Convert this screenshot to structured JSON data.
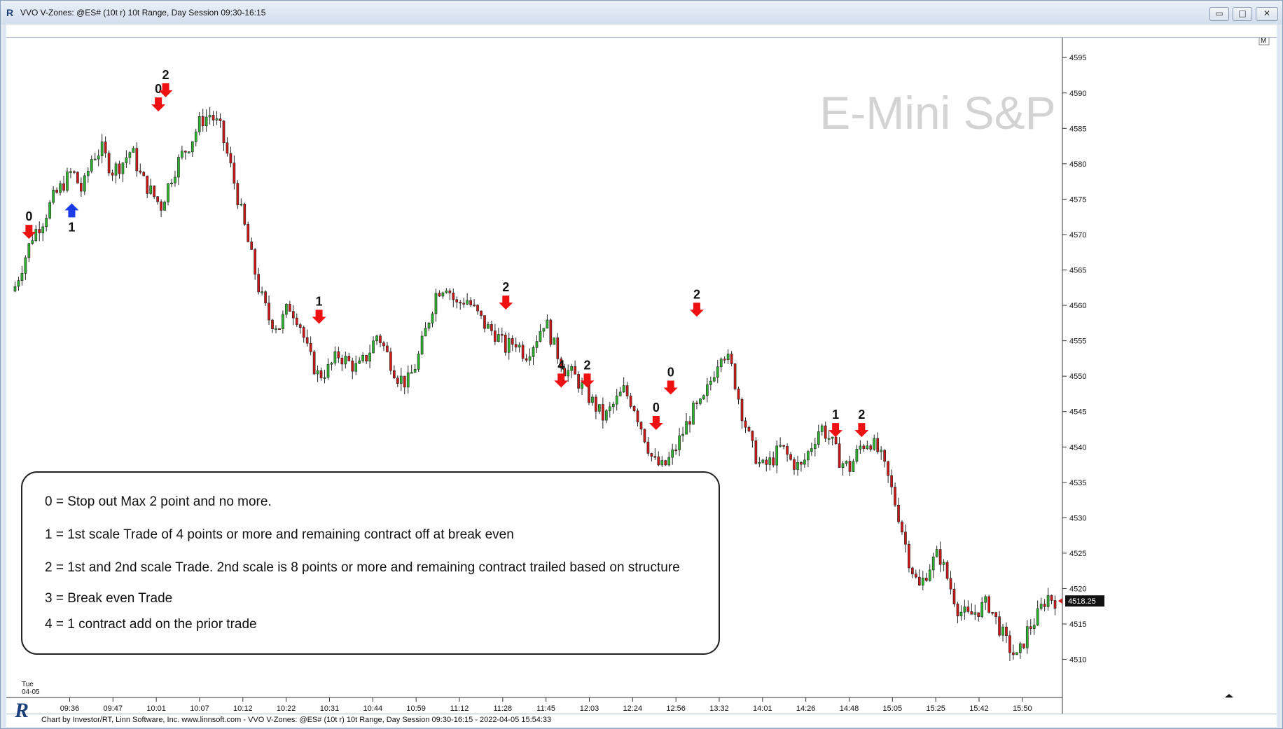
{
  "window": {
    "title": "VVO V-Zones: @ES# (10t r) 10t Range, Day Session 09:30-16:15",
    "buttons": {
      "minimize": "▭",
      "maximize": "□",
      "close": "✕"
    }
  },
  "footer": {
    "text": "Chart by Investor/RT, Linn Software, Inc. www.linnsoft.com - VVO V-Zones: @ES# (10t r) 10t Range, Day Session 09:30-16:15 - 2022-04-05 15:54:33",
    "logo": "R"
  },
  "chart_data": {
    "type": "candlestick",
    "watermark": "E-Mini S&P",
    "price_axis": {
      "ticks": [
        4510,
        4515,
        4520,
        4525,
        4530,
        4535,
        4540,
        4545,
        4550,
        4555,
        4560,
        4565,
        4570,
        4575,
        4580,
        4585,
        4590,
        4595
      ],
      "ylim": [
        4506,
        4597
      ],
      "last_price": "4518.25",
      "corner_label": "M"
    },
    "time_axis": {
      "date_label": [
        "Tue",
        "04-05"
      ],
      "ticks": [
        "09:36",
        "09:47",
        "10:01",
        "10:07",
        "10:12",
        "10:22",
        "10:31",
        "10:44",
        "10:59",
        "11:12",
        "11:28",
        "11:45",
        "12:03",
        "12:24",
        "12:56",
        "13:32",
        "14:01",
        "14:26",
        "14:48",
        "15:05",
        "15:25",
        "15:42",
        "15:50"
      ]
    },
    "close_path": [
      4562,
      4566,
      4570,
      4572,
      4575,
      4577,
      4579,
      4576,
      4581,
      4582,
      4579,
      4580,
      4582,
      4578,
      4576,
      4574,
      4578,
      4581,
      4583,
      4586,
      4587,
      4585,
      4580,
      4574,
      4568,
      4562,
      4558,
      4557,
      4560,
      4558,
      4553,
      4550,
      4551,
      4553,
      4552,
      4551,
      4553,
      4556,
      4553,
      4550,
      4549,
      4552,
      4557,
      4562,
      4563,
      4560,
      4561,
      4559,
      4557,
      4556,
      4554,
      4555,
      4553,
      4555,
      4558,
      4554,
      4551,
      4550,
      4548,
      4546,
      4544,
      4546,
      4548,
      4546,
      4542,
      4538,
      4537,
      4539,
      4542,
      4545,
      4546,
      4550,
      4554,
      4551,
      4545,
      4540,
      4537,
      4538,
      4540,
      4538,
      4537,
      4540,
      4543,
      4541,
      4538,
      4537,
      4540,
      4541,
      4539,
      4535,
      4530,
      4524,
      4520,
      4523,
      4525,
      4521,
      4517,
      4516,
      4517,
      4518,
      4515,
      4512,
      4510,
      4514,
      4516,
      4519,
      4518.25
    ],
    "signals": [
      {
        "dir": "down",
        "label": "0",
        "time_frac": 0.015,
        "price": 4569
      },
      {
        "dir": "up",
        "label": "1",
        "time_frac": 0.056,
        "price": 4575
      },
      {
        "dir": "down",
        "label": "0",
        "time_frac": 0.139,
        "price": 4587
      },
      {
        "dir": "down",
        "label": "2",
        "time_frac": 0.146,
        "price": 4589
      },
      {
        "dir": "down",
        "label": "1",
        "time_frac": 0.293,
        "price": 4557
      },
      {
        "dir": "down",
        "label": "2",
        "time_frac": 0.472,
        "price": 4559
      },
      {
        "dir": "down",
        "label": "4",
        "time_frac": 0.525,
        "price": 4548
      },
      {
        "dir": "down",
        "label": "2",
        "time_frac": 0.55,
        "price": 4548
      },
      {
        "dir": "down",
        "label": "0",
        "time_frac": 0.616,
        "price": 4542
      },
      {
        "dir": "down",
        "label": "0",
        "time_frac": 0.63,
        "price": 4547
      },
      {
        "dir": "down",
        "label": "2",
        "time_frac": 0.655,
        "price": 4558
      },
      {
        "dir": "down",
        "label": "1",
        "time_frac": 0.788,
        "price": 4541
      },
      {
        "dir": "down",
        "label": "2",
        "time_frac": 0.813,
        "price": 4541
      }
    ],
    "legend": [
      "0 = Stop out  Max 2 point and no more.",
      "1 = 1st scale Trade of 4 points or more and remaining contract off at break even",
      "2 = 1st and 2nd scale Trade. 2nd scale is 8 points or more and remaining contract trailed based on structure",
      "3 = Break even Trade",
      "4 = 1 contract add on the prior trade"
    ],
    "colors": {
      "up": "#2db42d",
      "down": "#d01717",
      "sell_arrow": "#ee1111",
      "buy_arrow": "#1a3be6",
      "watermark": "#d3d3d3"
    }
  }
}
